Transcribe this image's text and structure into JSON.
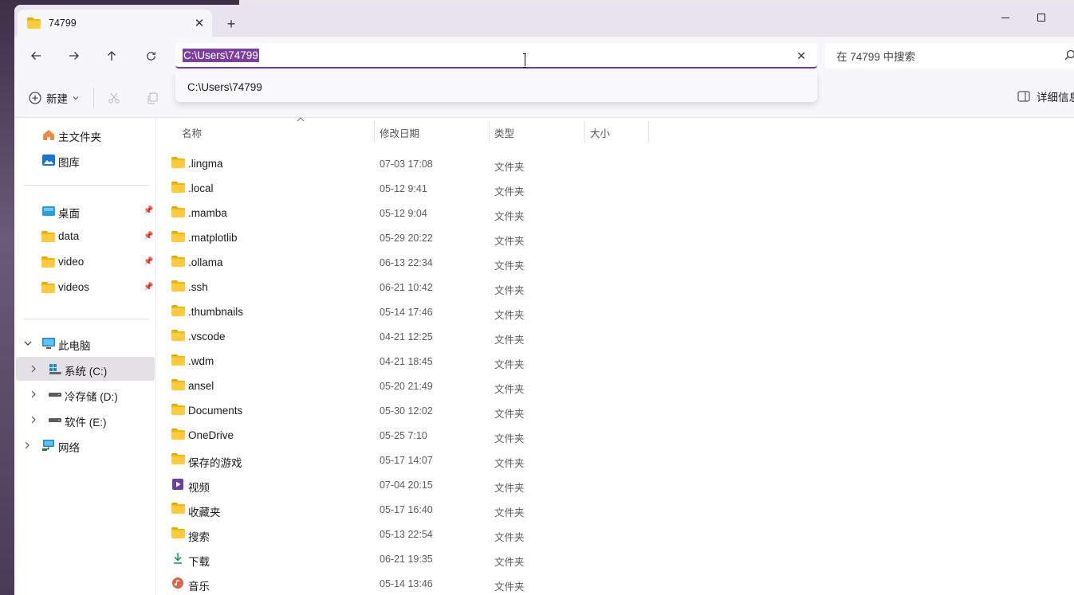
{
  "window": {
    "tab_title": "74799",
    "new_tab": "+",
    "tab_close": "✕"
  },
  "address": {
    "value": "C:\\Users\\74799",
    "suggestion": "C:\\Users\\74799",
    "clear": "✕"
  },
  "search": {
    "placeholder": "在 74799 中搜索"
  },
  "commandbar": {
    "new_label": "新建",
    "details_label": "详细信息"
  },
  "sidebar": {
    "quick": [
      {
        "label": "主文件夹",
        "icon": "home-icon"
      },
      {
        "label": "图库",
        "icon": "gallery-icon"
      }
    ],
    "pinned": [
      {
        "label": "桌面",
        "icon": "desktop-folder-icon"
      },
      {
        "label": "data",
        "icon": "folder-icon"
      },
      {
        "label": "video",
        "icon": "folder-icon"
      },
      {
        "label": "videos",
        "icon": "folder-icon"
      }
    ],
    "this_pc": "此电脑",
    "drives": [
      {
        "label": "系统 (C:)",
        "selected": true
      },
      {
        "label": "冷存储 (D:)",
        "selected": false
      },
      {
        "label": "软件 (E:)",
        "selected": false
      }
    ],
    "network": "网络"
  },
  "columns": {
    "name": "名称",
    "date": "修改日期",
    "type": "类型",
    "size": "大小"
  },
  "files": [
    {
      "name": ".lingma",
      "date": "07-03 17:08",
      "type": "文件夹",
      "icon": "folder-icon"
    },
    {
      "name": ".local",
      "date": "05-12 9:41",
      "type": "文件夹",
      "icon": "folder-icon"
    },
    {
      "name": ".mamba",
      "date": "05-12 9:04",
      "type": "文件夹",
      "icon": "folder-icon"
    },
    {
      "name": ".matplotlib",
      "date": "05-29 20:22",
      "type": "文件夹",
      "icon": "folder-icon"
    },
    {
      "name": ".ollama",
      "date": "06-13 22:34",
      "type": "文件夹",
      "icon": "folder-icon"
    },
    {
      "name": ".ssh",
      "date": "06-21 10:42",
      "type": "文件夹",
      "icon": "folder-icon"
    },
    {
      "name": ".thumbnails",
      "date": "05-14 17:46",
      "type": "文件夹",
      "icon": "folder-icon"
    },
    {
      "name": ".vscode",
      "date": "04-21 12:25",
      "type": "文件夹",
      "icon": "folder-icon"
    },
    {
      "name": ".wdm",
      "date": "04-21 18:45",
      "type": "文件夹",
      "icon": "folder-icon"
    },
    {
      "name": "ansel",
      "date": "05-20 21:49",
      "type": "文件夹",
      "icon": "folder-icon"
    },
    {
      "name": "Documents",
      "date": "05-30 12:02",
      "type": "文件夹",
      "icon": "folder-icon"
    },
    {
      "name": "OneDrive",
      "date": "05-25 7:10",
      "type": "文件夹",
      "icon": "folder-icon"
    },
    {
      "name": "保存的游戏",
      "date": "05-17 14:07",
      "type": "文件夹",
      "icon": "folder-icon"
    },
    {
      "name": "视频",
      "date": "07-04 20:15",
      "type": "文件夹",
      "icon": "video-folder-icon"
    },
    {
      "name": "收藏夹",
      "date": "05-17 16:40",
      "type": "文件夹",
      "icon": "folder-icon"
    },
    {
      "name": "搜索",
      "date": "05-13 22:54",
      "type": "文件夹",
      "icon": "folder-icon"
    },
    {
      "name": "下载",
      "date": "06-21 19:35",
      "type": "文件夹",
      "icon": "download-icon"
    },
    {
      "name": "音乐",
      "date": "05-14 13:46",
      "type": "文件夹",
      "icon": "music-folder-icon"
    }
  ],
  "colors": {
    "accent": "#7b3f9e",
    "folder": "#ffcb3d",
    "selected_bg": "#e3e1e6"
  }
}
